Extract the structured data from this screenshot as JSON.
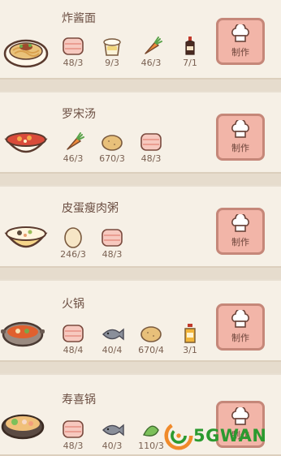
{
  "recipes": [
    {
      "name": "炸酱面",
      "dish_icon": "noodles-bowl-icon",
      "make_label": "制作",
      "ingredients": [
        {
          "icon": "pork-meat-icon",
          "qty": "48/3"
        },
        {
          "icon": "flour-icon",
          "qty": "9/3"
        },
        {
          "icon": "carrot-icon",
          "qty": "46/3"
        },
        {
          "icon": "soy-sauce-icon",
          "qty": "7/1"
        }
      ]
    },
    {
      "name": "罗宋汤",
      "dish_icon": "borscht-soup-icon",
      "make_label": "制作",
      "ingredients": [
        {
          "icon": "carrot-icon",
          "qty": "46/3"
        },
        {
          "icon": "potato-icon",
          "qty": "670/3"
        },
        {
          "icon": "pork-meat-icon",
          "qty": "48/3"
        }
      ]
    },
    {
      "name": "皮蛋瘦肉粥",
      "dish_icon": "congee-bowl-icon",
      "make_label": "制作",
      "ingredients": [
        {
          "icon": "egg-icon",
          "qty": "246/3"
        },
        {
          "icon": "pork-meat-icon",
          "qty": "48/3"
        }
      ]
    },
    {
      "name": "火锅",
      "dish_icon": "hotpot-icon",
      "make_label": "制作",
      "ingredients": [
        {
          "icon": "pork-meat-icon",
          "qty": "48/4"
        },
        {
          "icon": "fish-icon",
          "qty": "40/4"
        },
        {
          "icon": "potato-icon",
          "qty": "670/4"
        },
        {
          "icon": "cooking-oil-icon",
          "qty": "3/1"
        }
      ]
    },
    {
      "name": "寿喜锅",
      "dish_icon": "sukiyaki-pot-icon",
      "make_label": "制作",
      "ingredients": [
        {
          "icon": "pork-meat-icon",
          "qty": "48/3"
        },
        {
          "icon": "fish-icon",
          "qty": "40/3"
        },
        {
          "icon": "vegetable-icon",
          "qty": "110/3"
        }
      ]
    }
  ],
  "watermark": {
    "text": "5GWAN"
  },
  "colors": {
    "card_bg": "#f6f0e6",
    "page_bg": "#e6dccd",
    "button_bg": "#f2b5a8",
    "button_border": "#c58779",
    "text": "#6c4f43"
  }
}
